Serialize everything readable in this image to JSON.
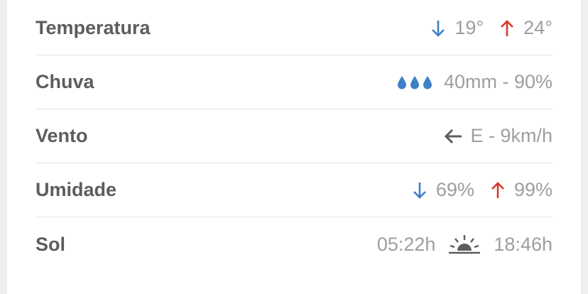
{
  "colors": {
    "down": "#3f7fc8",
    "up": "#d43a2a",
    "label": "#5d5d5d",
    "value": "#9e9e9e"
  },
  "rows": {
    "temperatura": {
      "label": "Temperatura",
      "min": "19°",
      "max": "24°"
    },
    "chuva": {
      "label": "Chuva",
      "value": "40mm - 90%",
      "icon": "raindrops-icon"
    },
    "vento": {
      "label": "Vento",
      "value": "E - 9km/h",
      "icon": "arrow-left-icon"
    },
    "umidade": {
      "label": "Umidade",
      "min": "69%",
      "max": "99%"
    },
    "sol": {
      "label": "Sol",
      "sunrise": "05:22h",
      "sunset": "18:46h",
      "icon": "sunrise-icon"
    }
  }
}
